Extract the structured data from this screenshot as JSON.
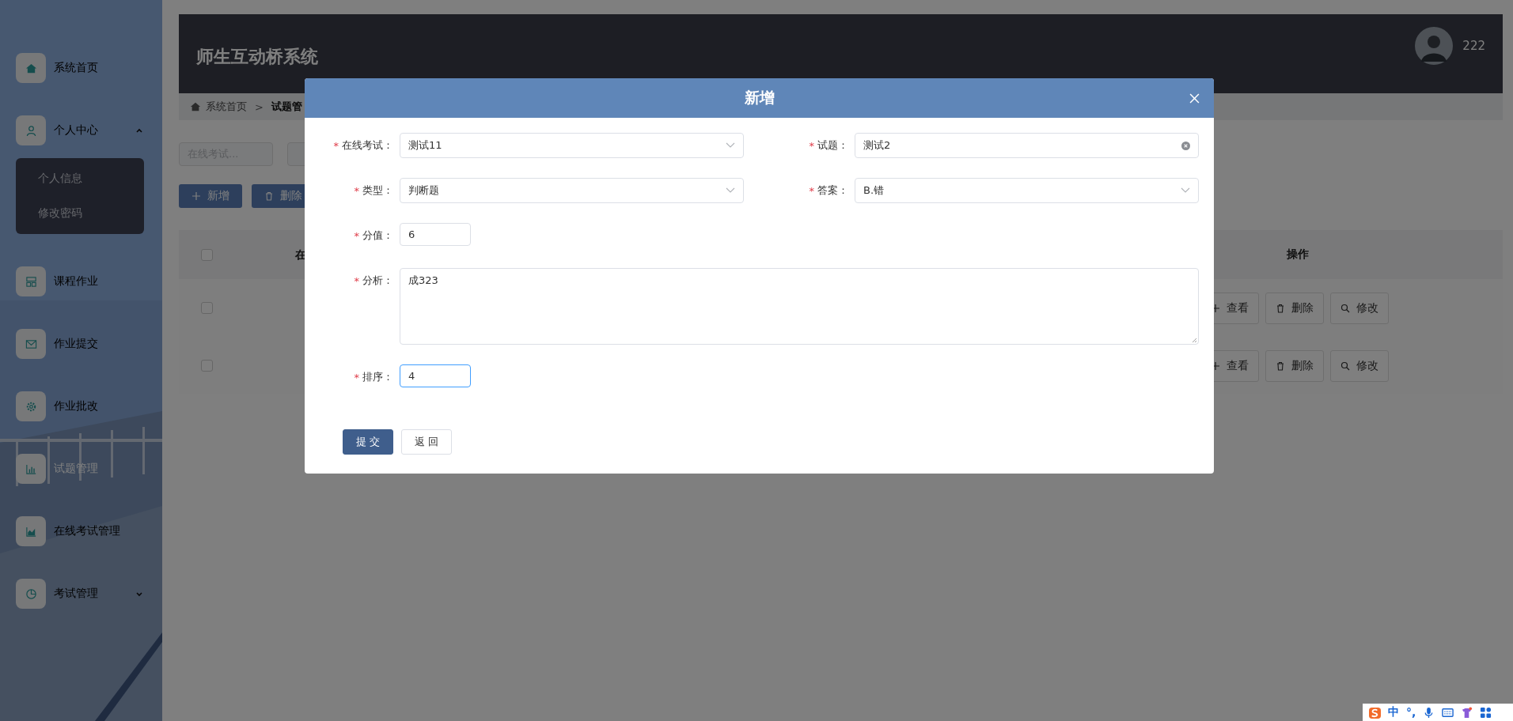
{
  "sidebar": {
    "items": [
      {
        "label": "系统首页",
        "selected": false
      },
      {
        "label": "个人中心",
        "selected": false,
        "expanded": true,
        "children": [
          {
            "label": "个人信息"
          },
          {
            "label": "修改密码"
          }
        ]
      },
      {
        "label": "课程作业",
        "selected": false
      },
      {
        "label": "作业提交",
        "selected": false
      },
      {
        "label": "作业批改",
        "selected": false
      },
      {
        "label": "试题管理",
        "selected": true
      },
      {
        "label": "在线考试管理",
        "selected": false
      },
      {
        "label": "考试管理",
        "selected": false,
        "expanded": false
      }
    ]
  },
  "header": {
    "title": "师生互动桥系统",
    "user": "222"
  },
  "breadcrumb": {
    "separator": ">",
    "items": [
      {
        "label": "系统首页"
      },
      {
        "label": "试题管"
      }
    ]
  },
  "search_fields": [
    {
      "kind": "text",
      "placeholder": "在线考试..."
    },
    {
      "kind": "text"
    }
  ],
  "toolbar": [
    {
      "label": "新增",
      "kind": "add"
    },
    {
      "label": "删除",
      "kind": "delete"
    }
  ],
  "table": {
    "header_checked": false,
    "columns": [
      {
        "label": "在"
      },
      {
        "label": "操作"
      }
    ],
    "rows": [
      {
        "checked": false,
        "actions": [
          "查看",
          "删除",
          "修改"
        ]
      },
      {
        "checked": false,
        "actions": [
          "查看",
          "删除",
          "修改"
        ]
      }
    ]
  },
  "dialog": {
    "title": "新增",
    "fields": [
      {
        "label": "在线考试：",
        "value": "测试11",
        "kind": "select",
        "required_mark": "*",
        "focused": false
      },
      {
        "label": "试题：",
        "value": "测试2",
        "kind": "clearable",
        "required_mark": "*",
        "focused": false
      },
      {
        "label": "类型：",
        "value": "判断题",
        "kind": "select",
        "required_mark": "*",
        "focused": false
      },
      {
        "label": "答案：",
        "value": "B.错",
        "kind": "select",
        "required_mark": "*",
        "focused": false
      },
      {
        "label": "分值：",
        "value": "6",
        "kind": "short",
        "required_mark": "*",
        "focused": false
      },
      {
        "label": "分析：",
        "value": "成323",
        "kind": "textarea",
        "required_mark": "*",
        "focused": false
      },
      {
        "label": "排序：",
        "value": "4",
        "kind": "short",
        "required_mark": "*",
        "focused": true
      }
    ],
    "buttons": [
      {
        "label": "提 交",
        "kind": "primary"
      },
      {
        "label": "返 回",
        "kind": "plain"
      }
    ]
  },
  "ime_bar": {
    "mode": "中",
    "punctuation": "°,"
  }
}
